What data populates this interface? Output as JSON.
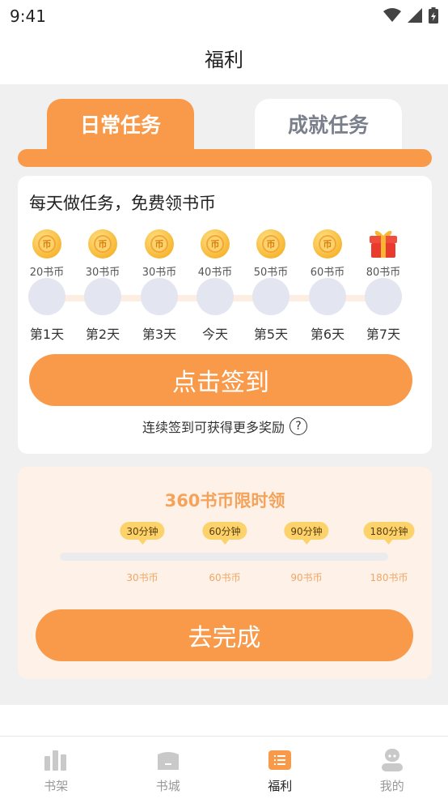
{
  "status_bar": {
    "time": "9:41"
  },
  "header": {
    "title": "福利"
  },
  "tabs": [
    {
      "label": "日常任务",
      "active": true
    },
    {
      "label": "成就任务",
      "active": false
    }
  ],
  "signin": {
    "title": "每天做任务，免费领书币",
    "coin_glyph": "币",
    "days": [
      {
        "coins": "20书币",
        "label": "第1天",
        "reward": "coin"
      },
      {
        "coins": "30书币",
        "label": "第2天",
        "reward": "coin"
      },
      {
        "coins": "30书币",
        "label": "第3天",
        "reward": "coin"
      },
      {
        "coins": "40书币",
        "label": "今天",
        "reward": "coin"
      },
      {
        "coins": "50书币",
        "label": "第5天",
        "reward": "coin"
      },
      {
        "coins": "60书币",
        "label": "第6天",
        "reward": "coin"
      },
      {
        "coins": "80书币",
        "label": "第7天",
        "reward": "gift-icon"
      }
    ],
    "button_label": "点击签到",
    "note": "连续签到可获得更多奖励",
    "help_glyph": "?"
  },
  "timed": {
    "title": "360书币限时领",
    "milestones": [
      {
        "time": "30分钟",
        "reward": "30书币"
      },
      {
        "time": "60分钟",
        "reward": "60书币"
      },
      {
        "time": "90分钟",
        "reward": "90书币"
      },
      {
        "time": "180分钟",
        "reward": "180书币"
      }
    ],
    "progress": 0,
    "button_label": "去完成"
  },
  "nav": [
    {
      "label": "书架",
      "icon": "bookshelf-icon",
      "active": false
    },
    {
      "label": "书城",
      "icon": "bookstore-icon",
      "active": false
    },
    {
      "label": "福利",
      "icon": "welfare-icon",
      "active": true
    },
    {
      "label": "我的",
      "icon": "profile-icon",
      "active": false
    }
  ],
  "colors": {
    "accent": "#f89a4a",
    "coin": "#f7b733",
    "timed_title": "#f5a35a",
    "nav_inactive": "#c9c9c9"
  }
}
